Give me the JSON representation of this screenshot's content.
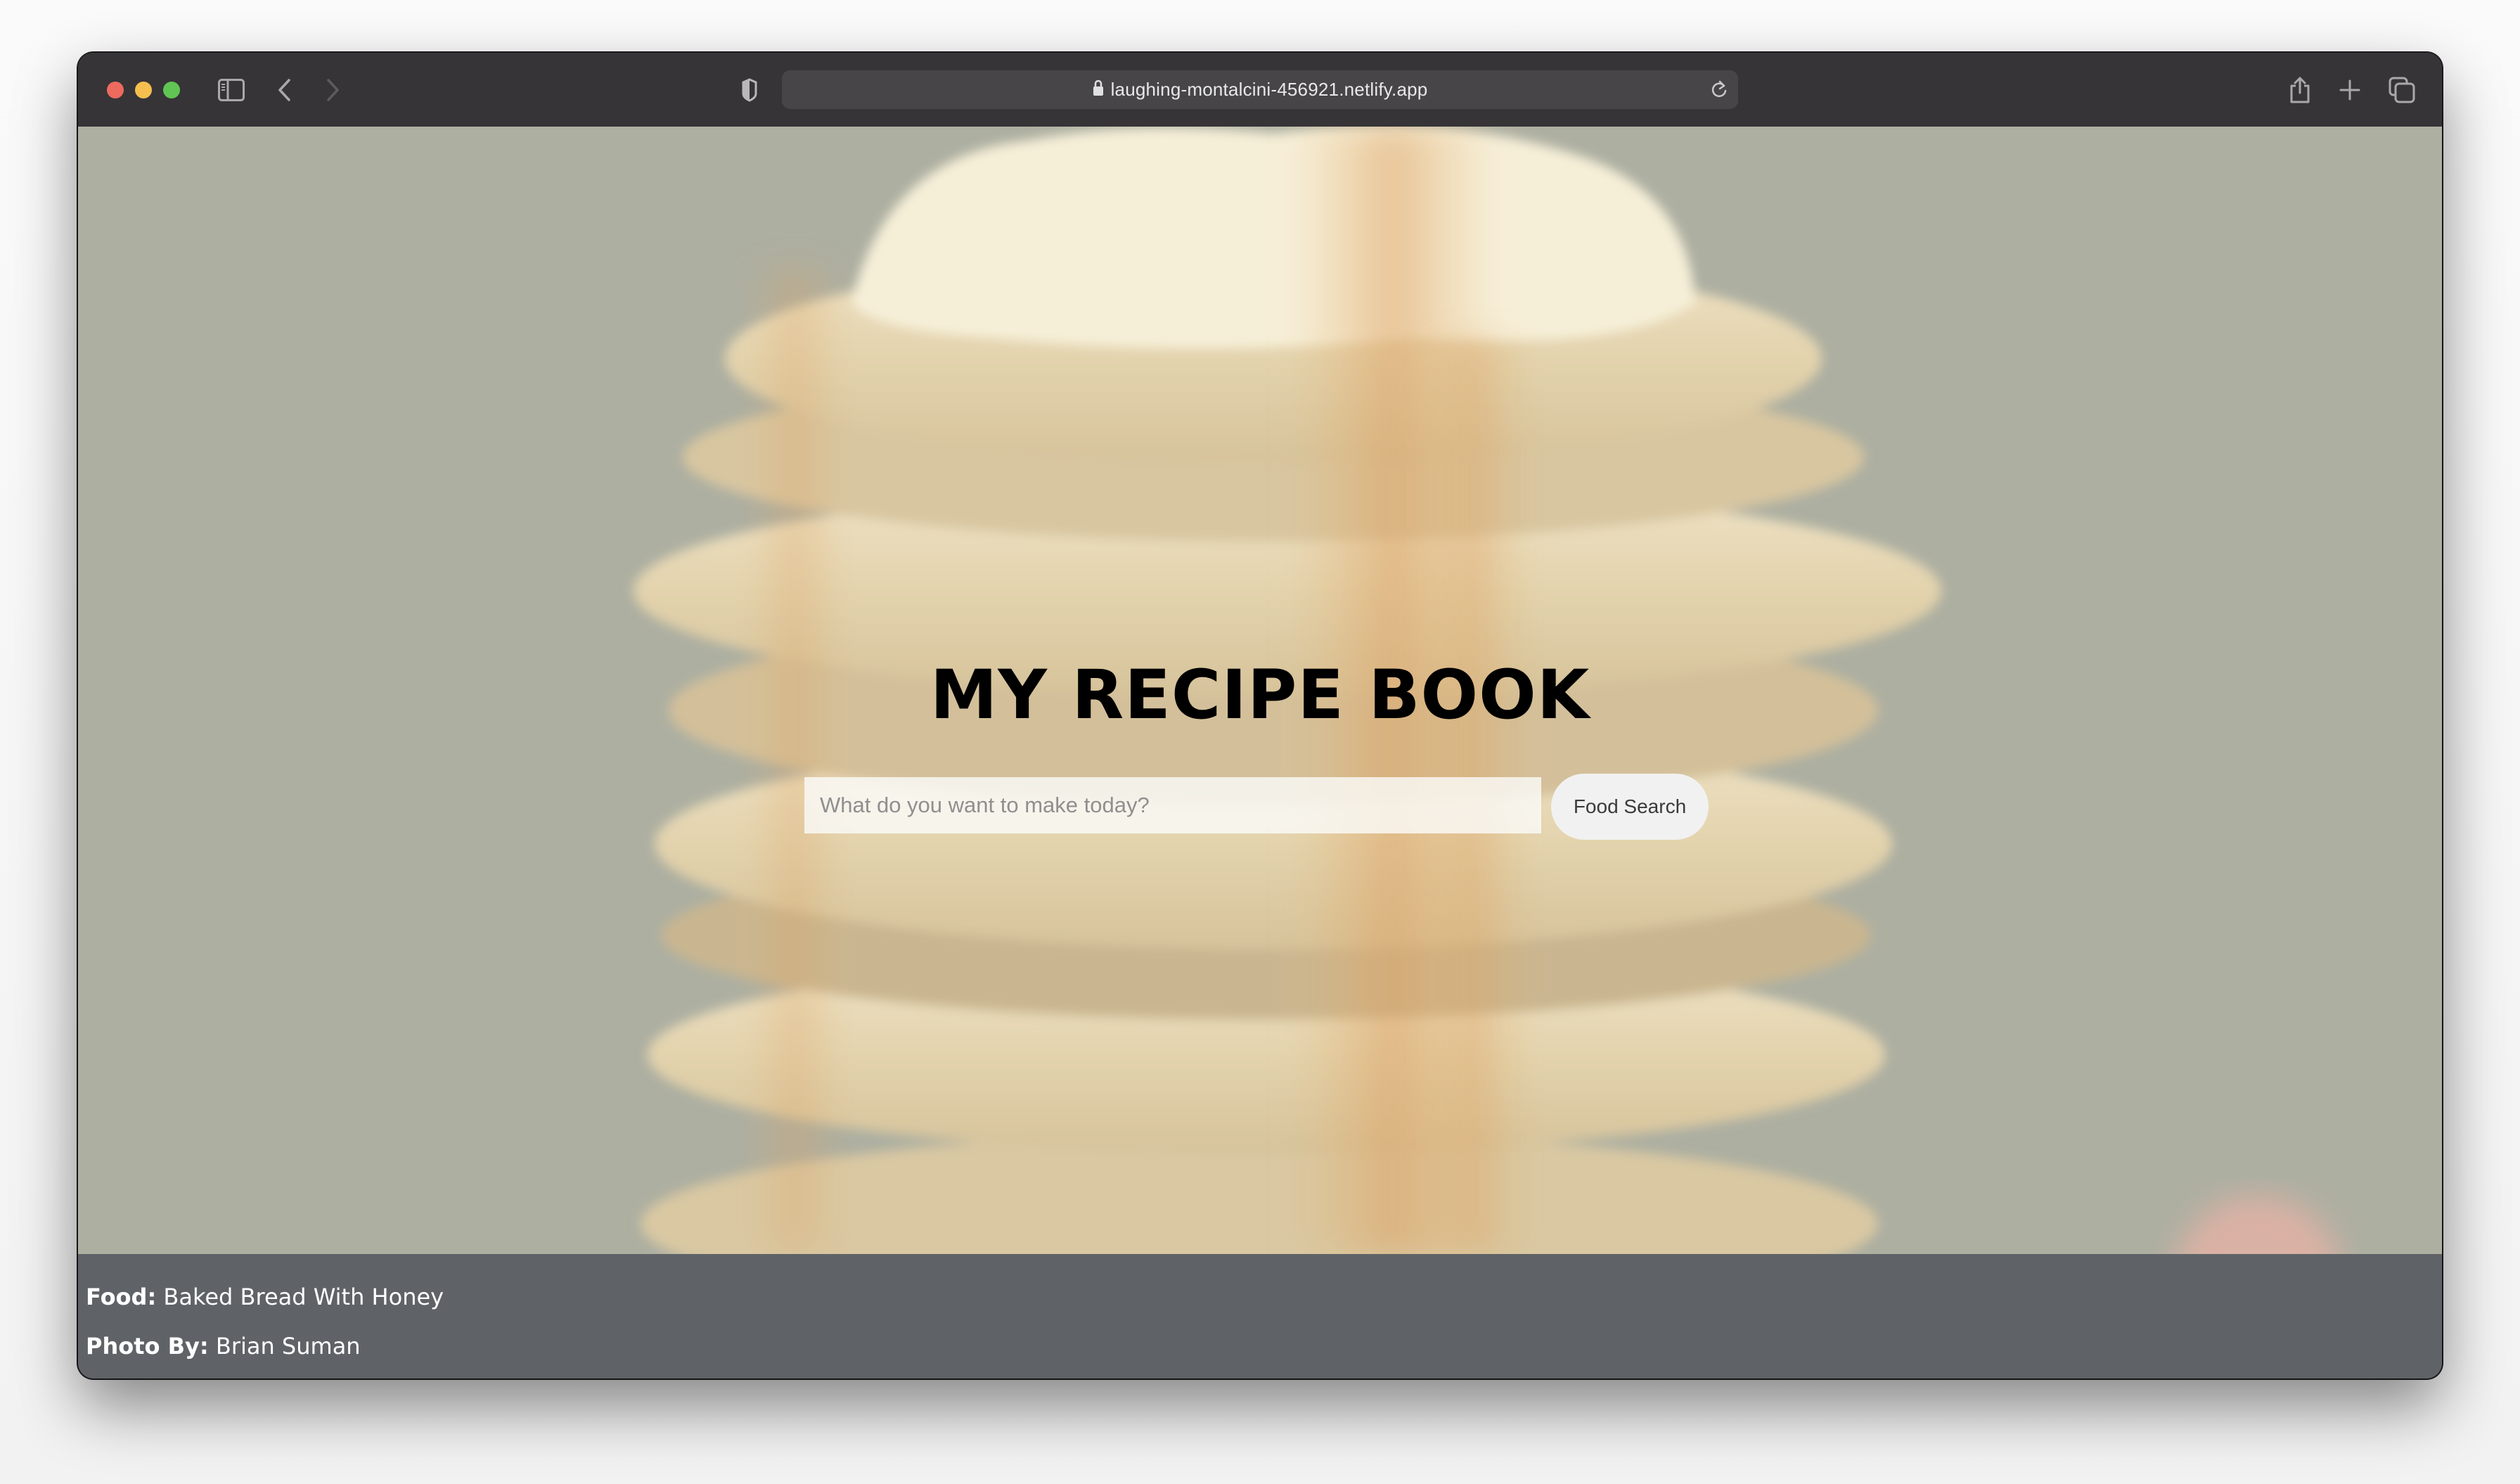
{
  "browser": {
    "url": "laughing-montalcini-456921.netlify.app",
    "icons": {
      "sidebar": "sidebar-icon",
      "back": "chevron-left-icon",
      "forward": "chevron-right-icon",
      "privacy": "shield-icon",
      "lock": "lock-icon",
      "reload": "reload-icon",
      "share": "share-icon",
      "new_tab": "plus-icon",
      "tabs": "tab-overview-icon"
    },
    "colors": {
      "titlebar": "#363437",
      "urlbar": "#474548",
      "close": "#ed6a5e",
      "minimize": "#f4bf4f",
      "zoom": "#61c554"
    }
  },
  "hero": {
    "title": "MY RECIPE BOOK",
    "search": {
      "placeholder": "What do you want to make today?",
      "value": ""
    },
    "search_button_label": "Food Search",
    "background_color": "#adafa1"
  },
  "footer": {
    "food_label": "Food:",
    "food_value": " Baked Bread With Honey",
    "photo_label": "Photo By:",
    "photo_value": " Brian Suman",
    "background_color": "#5f6368"
  }
}
